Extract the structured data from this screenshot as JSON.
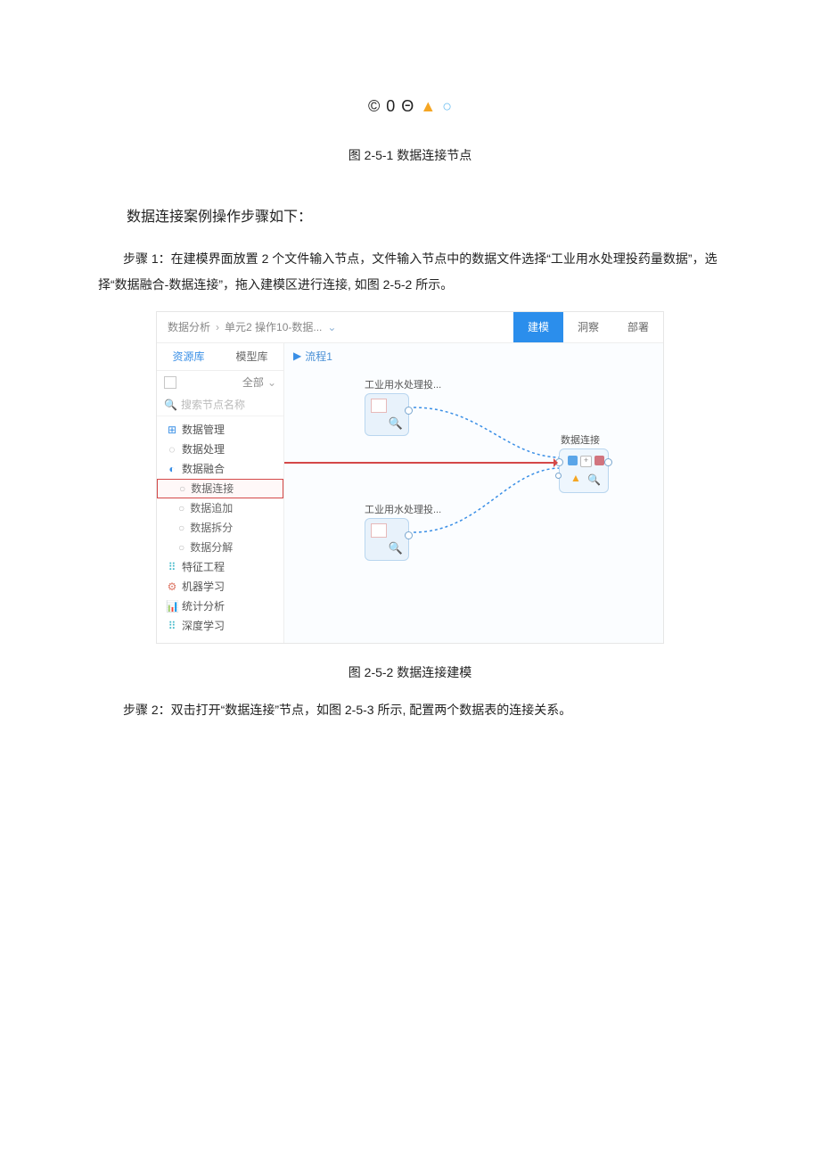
{
  "symbols": {
    "s1": "©",
    "s2": "0",
    "s3": "Θ",
    "s4": "▲",
    "s5": "○"
  },
  "caption1": "图 2-5-1 数据连接节点",
  "intro": "数据连接案例操作步骤如下：",
  "step1": "步骤 1：在建模界面放置 2 个文件输入节点，文件输入节点中的数据文件选择“工业用水处理投药量数据”，选择“数据融合-数据连接”，拖入建模区进行连接, 如图 2-5-2 所示。",
  "caption2": "图 2-5-2 数据连接建模",
  "step2": "步骤 2：双击打开“数据连接”节点，如图 2-5-3 所示, 配置两个数据表的连接关系。",
  "app": {
    "breadcrumb": {
      "root": "数据分析",
      "sep": "›",
      "item": "单元2 操作10-数据...",
      "drop": "⌄"
    },
    "topTabs": {
      "t1": "建模",
      "t2": "洞察",
      "t3": "部署"
    },
    "sideTabs": {
      "a": "资源库",
      "b": "模型库"
    },
    "filter": {
      "all": "全部",
      "drop": "⌄"
    },
    "search": {
      "placeholder": "搜索节点名称"
    },
    "tree": {
      "n1": "数据管理",
      "n2": "数据处理",
      "n3": "数据融合",
      "s1": "数据连接",
      "s2": "数据追加",
      "s3": "数据拆分",
      "s4": "数据分解",
      "n4": "特征工程",
      "n5": "机器学习",
      "n6": "统计分析",
      "n7": "深度学习"
    },
    "canvas": {
      "procTab": "流程1",
      "node1": "工业用水处理投...",
      "node2": "工业用水处理投...",
      "nodeMerge": "数据连接"
    }
  }
}
